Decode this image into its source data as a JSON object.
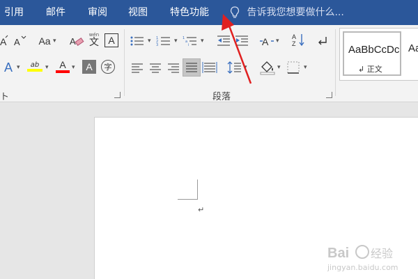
{
  "menubar": {
    "tabs": [
      "引用",
      "邮件",
      "审阅",
      "视图",
      "特色功能"
    ],
    "tell_me": "告诉我您想要做什么..."
  },
  "ribbon": {
    "font_group": {
      "change_case": "Aa",
      "phonetic_label": "wén",
      "phonetic_char": "文",
      "char_border": "A",
      "text_effect": "A",
      "highlight": "ab",
      "font_color": "A",
      "char_shading": "A",
      "enclose_char": "字",
      "group_label": "ト"
    },
    "paragraph_group": {
      "label": "段落"
    },
    "styles_group": {
      "style1_preview": "AaBbCcDc",
      "style1_label": "↲ 正文",
      "style2_preview": "AaB"
    }
  },
  "document": {
    "paragraph_mark": "↵"
  },
  "watermark": {
    "text": "jingyan.baidu.com",
    "brand": "Baidu 经验"
  },
  "colors": {
    "title_bar": "#2b579a",
    "arrow": "#e02020",
    "highlight": "#ffff00",
    "font_color": "#ff0000"
  }
}
